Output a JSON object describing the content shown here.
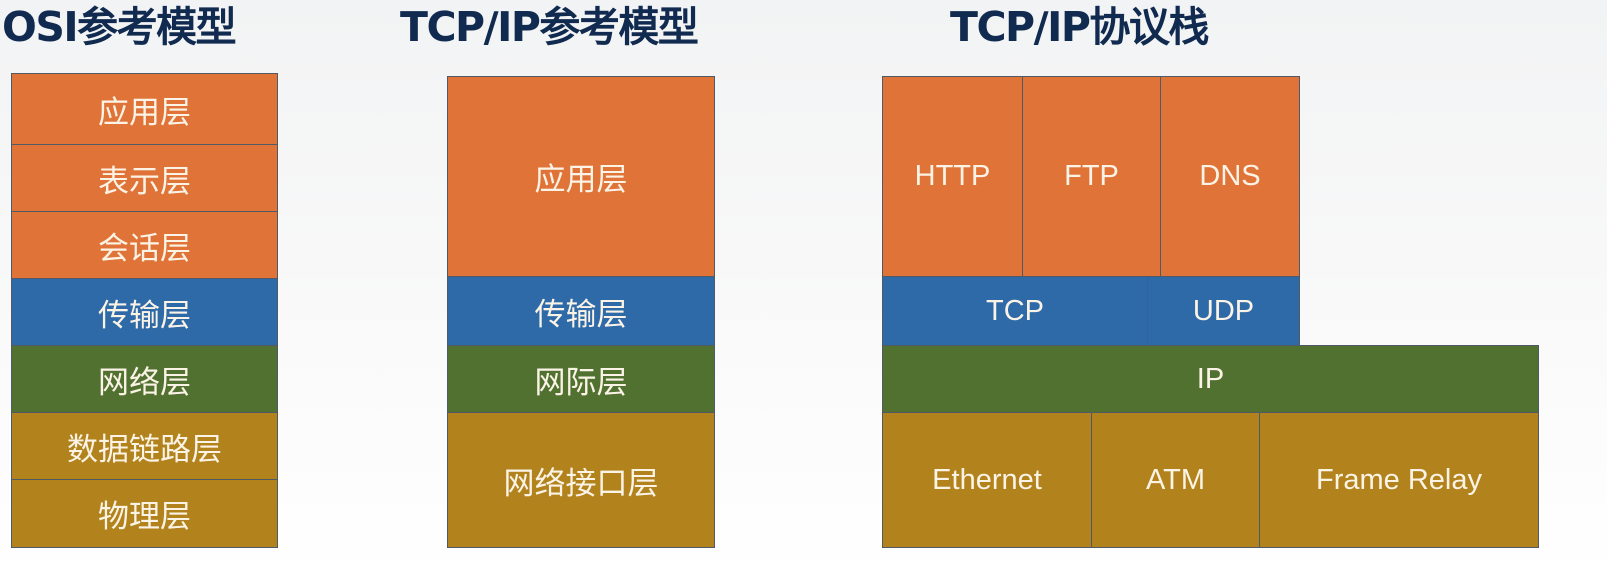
{
  "titles": {
    "osi": "OSI参考模型",
    "tcpip_model": "TCP/IP参考模型",
    "tcpip_stack": "TCP/IP协议栈"
  },
  "colors": {
    "application": "#e07438",
    "transport": "#2e6aa8",
    "network": "#517130",
    "link": "#b2831c",
    "title_text": "#102a50"
  },
  "osi_layers": [
    {
      "label": "应用层",
      "group": "application"
    },
    {
      "label": "表示层",
      "group": "application"
    },
    {
      "label": "会话层",
      "group": "application"
    },
    {
      "label": "传输层",
      "group": "transport"
    },
    {
      "label": "网络层",
      "group": "network"
    },
    {
      "label": "数据链路层",
      "group": "link"
    },
    {
      "label": "物理层",
      "group": "link"
    }
  ],
  "tcpip_layers": [
    {
      "label": "应用层",
      "group": "application"
    },
    {
      "label": "传输层",
      "group": "transport"
    },
    {
      "label": "网际层",
      "group": "network"
    },
    {
      "label": "网络接口层",
      "group": "link"
    }
  ],
  "protocol_stack": {
    "application": [
      "HTTP",
      "FTP",
      "DNS"
    ],
    "transport": [
      "TCP",
      "UDP"
    ],
    "network": [
      "IP"
    ],
    "link": [
      "Ethernet",
      "ATM",
      "Frame Relay"
    ]
  }
}
